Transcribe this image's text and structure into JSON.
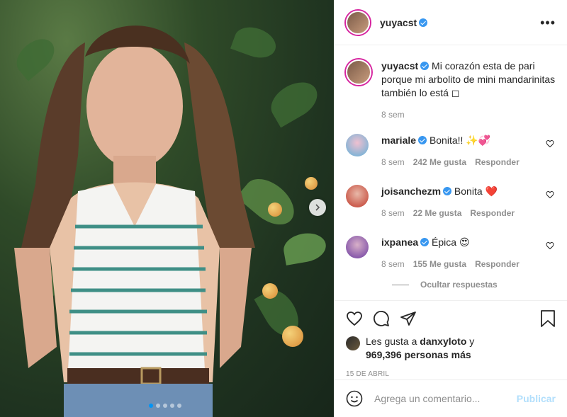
{
  "post": {
    "image_alt": "",
    "carousel": {
      "total": 5,
      "active": 1
    }
  },
  "header": {
    "username": "yuyacst",
    "more_icon": "more-horizontal-icon"
  },
  "caption": {
    "username": "yuyacst",
    "text": "Mi corazón esta de pari porque mi arbolito de mini mandarinitas también lo está ◻",
    "time": "8 sem"
  },
  "comments": [
    {
      "username": "mariale",
      "text": "Bonita!! ✨💞",
      "time": "8 sem",
      "likes": "242 Me gusta",
      "reply": "Responder",
      "avatar_color": "#5fb0d8"
    },
    {
      "username": "joisanchezm",
      "text": "Bonita ❤️",
      "time": "8 sem",
      "likes": "22 Me gusta",
      "reply": "Responder",
      "avatar_color": "#c0392b"
    },
    {
      "username": "ixpanea",
      "text": "Épica 😍",
      "time": "8 sem",
      "likes": "155 Me gusta",
      "reply": "Responder",
      "avatar_color": "#6b3aa0"
    }
  ],
  "hide_replies": "Ocultar respuestas",
  "likes": {
    "prefix": "Les gusta a ",
    "user": "danxyloto",
    "conj": " y",
    "count": "969,396 personas más"
  },
  "date": "15 DE ABRIL",
  "add_comment": {
    "placeholder": "Agrega un comentario...",
    "post_label": "Publicar"
  },
  "colors": {
    "verified": "#3897f0",
    "post_disabled": "#b2dffc",
    "meta": "#8e8e8e"
  }
}
